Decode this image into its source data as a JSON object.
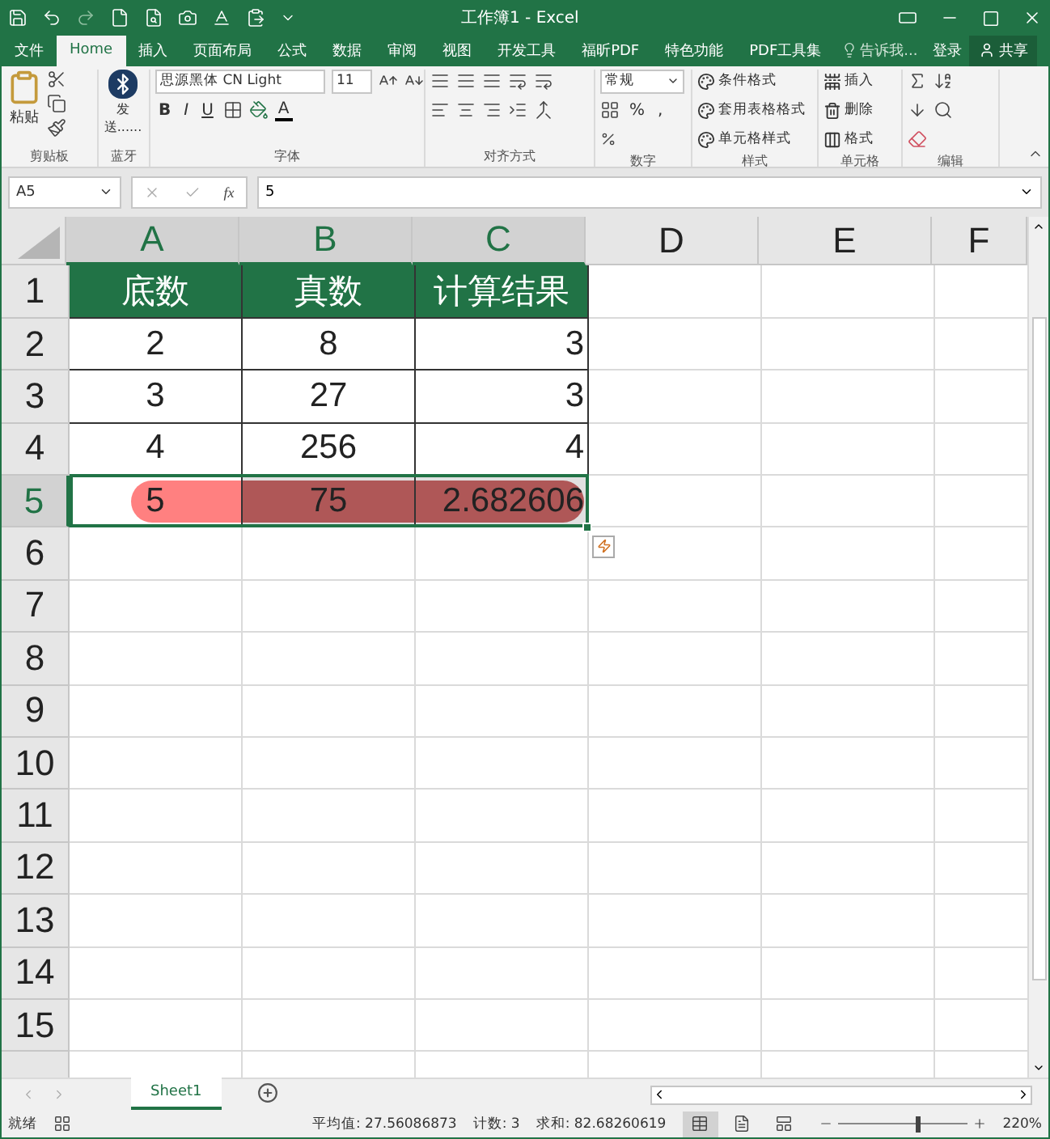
{
  "window": {
    "title": "工作簿1 - Excel"
  },
  "tabs": [
    {
      "label": "文件",
      "selected": false
    },
    {
      "label": "Home",
      "selected": true
    },
    {
      "label": "插入",
      "selected": false
    },
    {
      "label": "页面布局",
      "selected": false
    },
    {
      "label": "公式",
      "selected": false
    },
    {
      "label": "数据",
      "selected": false
    },
    {
      "label": "审阅",
      "selected": false
    },
    {
      "label": "视图",
      "selected": false
    },
    {
      "label": "开发工具",
      "selected": false
    },
    {
      "label": "福昕PDF",
      "selected": false
    },
    {
      "label": "特色功能",
      "selected": false
    },
    {
      "label": "PDF工具集",
      "selected": false
    }
  ],
  "tell_me": {
    "placeholder": "告诉我..."
  },
  "login": "登录",
  "share": "共享",
  "ribbon": {
    "clipboard": {
      "paste": "粘贴",
      "label": "剪贴板"
    },
    "bluetooth": {
      "send": "发送......",
      "label": "蓝牙"
    },
    "font": {
      "font_name": "思源黑体 CN Light",
      "font_size": "11",
      "bold": "B",
      "italic": "I",
      "underline": "U",
      "font_color": "A",
      "label": "字体"
    },
    "alignment": {
      "label": "对齐方式"
    },
    "number": {
      "format": "常规",
      "percent": "%",
      "comma": ",",
      "label": "数字"
    },
    "styles": {
      "items": [
        "条件格式",
        "套用表格格式",
        "单元格样式"
      ],
      "label": "样式"
    },
    "cells": {
      "items": [
        "插入",
        "删除",
        "格式"
      ],
      "label": "单元格"
    },
    "editing": {
      "label": "编辑"
    }
  },
  "formula_bar": {
    "name_box": "A5",
    "function_label": "fx",
    "formula": "5"
  },
  "columns": [
    {
      "label": "A",
      "selected": true,
      "kind": "center"
    },
    {
      "label": "B",
      "selected": true,
      "kind": "center"
    },
    {
      "label": "C",
      "selected": true,
      "kind": "right"
    },
    {
      "label": "D",
      "selected": false,
      "kind": "right"
    },
    {
      "label": "E",
      "selected": false,
      "kind": "right"
    },
    {
      "label": "F",
      "selected": false,
      "kind": "right"
    }
  ],
  "rows": [
    {
      "number": "1",
      "kind": "header",
      "selected": false,
      "highlighted": false,
      "cells": [
        "底数",
        "真数",
        "计算结果"
      ]
    },
    {
      "number": "2",
      "kind": "data",
      "selected": false,
      "highlighted": false,
      "cells": [
        "2",
        "8",
        "3"
      ]
    },
    {
      "number": "3",
      "kind": "data",
      "selected": false,
      "highlighted": false,
      "cells": [
        "3",
        "27",
        "3"
      ]
    },
    {
      "number": "4",
      "kind": "data",
      "selected": false,
      "highlighted": false,
      "cells": [
        "4",
        "256",
        "4"
      ]
    },
    {
      "number": "5",
      "kind": "data",
      "selected": true,
      "highlighted": true,
      "cells": [
        "5",
        "75",
        "2.682606"
      ]
    },
    {
      "number": "6",
      "kind": "data",
      "selected": false,
      "highlighted": false
    },
    {
      "number": "7",
      "kind": "data",
      "selected": false,
      "highlighted": false
    },
    {
      "number": "8",
      "kind": "data",
      "selected": false,
      "highlighted": false
    },
    {
      "number": "9",
      "kind": "data",
      "selected": false,
      "highlighted": false
    },
    {
      "number": "10",
      "kind": "data",
      "selected": false,
      "highlighted": false
    },
    {
      "number": "11",
      "kind": "data",
      "selected": false,
      "highlighted": false
    },
    {
      "number": "12",
      "kind": "data",
      "selected": false,
      "highlighted": false
    },
    {
      "number": "13",
      "kind": "data",
      "selected": false,
      "highlighted": false
    },
    {
      "number": "14",
      "kind": "data",
      "selected": false,
      "highlighted": false
    },
    {
      "number": "15",
      "kind": "data",
      "selected": false,
      "highlighted": false
    }
  ],
  "sheets": [
    {
      "label": "Sheet1",
      "selected": true
    }
  ],
  "status_bar": {
    "ready": "就绪",
    "average": "平均值: 27.56086873",
    "count": "计数: 3",
    "sum": "求和: 82.68260619",
    "views": [
      {
        "kind": "normal",
        "selected": true
      },
      {
        "kind": "page_layout",
        "selected": false
      },
      {
        "kind": "page_break",
        "selected": false
      }
    ],
    "zoom": {
      "level": 0.6,
      "reading": "220%"
    }
  }
}
